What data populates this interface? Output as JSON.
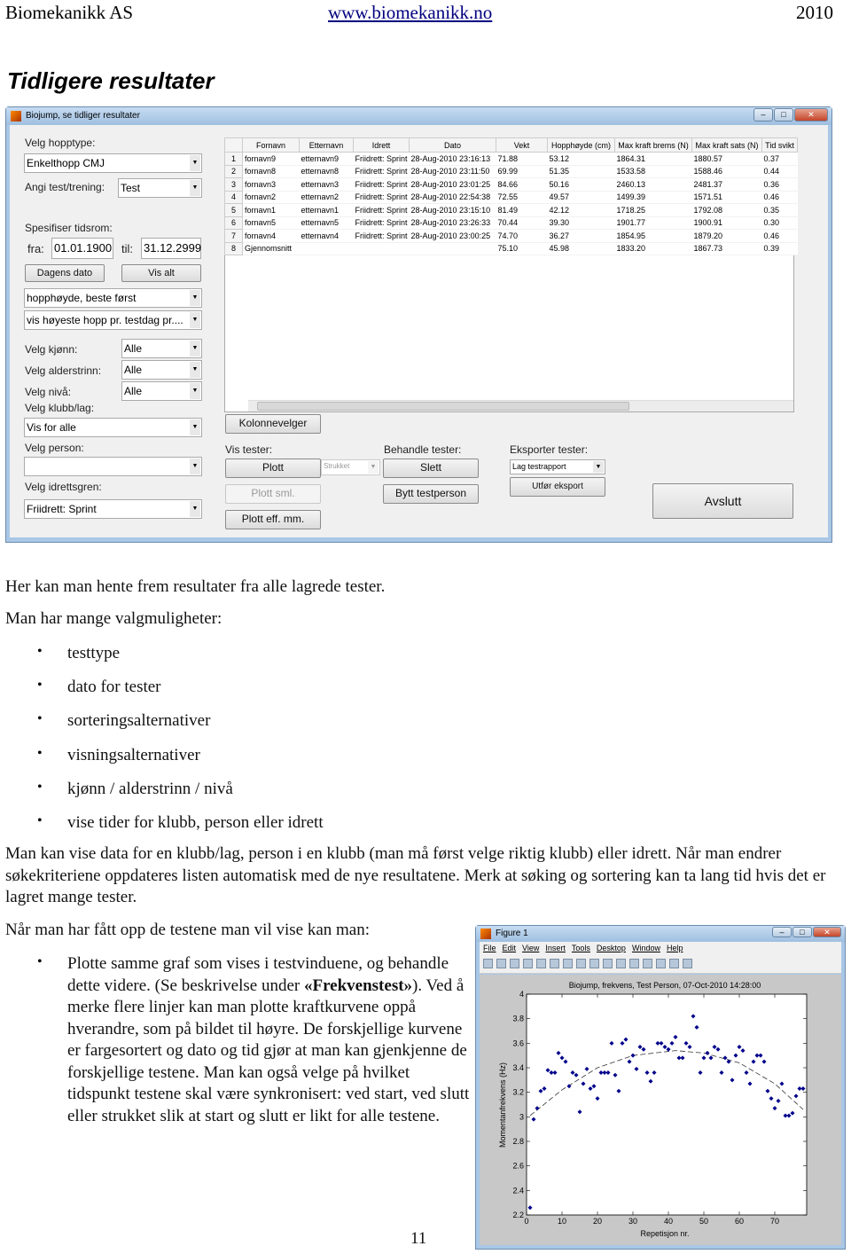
{
  "header": {
    "company": "Biomekanikk AS",
    "url": "www.biomekanikk.no",
    "year": "2010"
  },
  "title": "Tidligere resultater",
  "app": {
    "window_title": "Biojump, se tidliger resultater",
    "labels": {
      "hopptype": "Velg hopptype:",
      "test_trening": "Angi test/trening:",
      "tidsrom": "Spesifiser tidsrom:",
      "fra": "fra:",
      "til": "til:",
      "kjonn": "Velg kjønn:",
      "alderstrinn": "Velg alderstrinn:",
      "niva": "Velg nivå:",
      "klubb": "Velg klubb/lag:",
      "person": "Velg person:",
      "idrettsgren": "Velg idrettsgren:",
      "vis_tester": "Vis tester:",
      "behandle_tester": "Behandle tester:",
      "eksporter_tester": "Eksporter tester:"
    },
    "values": {
      "hopptype": "Enkelthopp CMJ",
      "test_trening": "Test",
      "fra": "01.01.1900",
      "til": "31.12.2999",
      "sortering": "hopphøyde, beste først",
      "visning": "vis høyeste hopp pr. testdag pr....",
      "kjonn": "Alle",
      "alderstrinn": "Alle",
      "niva": "Alle",
      "klubb": "Vis for alle",
      "person": "",
      "idrettsgren": "Friidrett: Sprint",
      "strukket": "Strukket",
      "eksport": "Lag testrapport"
    },
    "buttons": {
      "dagens_dato": "Dagens dato",
      "vis_alt": "Vis alt",
      "kolonnevelger": "Kolonnevelger",
      "plott": "Plott",
      "plott_sml": "Plott sml.",
      "plott_eff": "Plott eff. mm.",
      "slett": "Slett",
      "bytt": "Bytt testperson",
      "utfor": "Utfør eksport",
      "avslutt": "Avslutt"
    },
    "table": {
      "columns": [
        "Fornavn",
        "Etternavn",
        "Idrett",
        "Dato",
        "Vekt",
        "Hopphøyde (cm)",
        "Max kraft brems (N)",
        "Max kraft sats (N)",
        "Tid svikt"
      ],
      "rows": [
        [
          "1",
          "fornavn9",
          "etternavn9",
          "Friidrett: Sprint",
          "28-Aug-2010 23:16:13",
          "71.88",
          "53.12",
          "1864.31",
          "1880.57",
          "0.37"
        ],
        [
          "2",
          "fornavn8",
          "etternavn8",
          "Friidrett: Sprint",
          "28-Aug-2010 23:11:50",
          "69.99",
          "51.35",
          "1533.58",
          "1588.46",
          "0.44"
        ],
        [
          "3",
          "fornavn3",
          "etternavn3",
          "Friidrett: Sprint",
          "28-Aug-2010 23:01:25",
          "84.66",
          "50.16",
          "2460.13",
          "2481.37",
          "0.36"
        ],
        [
          "4",
          "fornavn2",
          "etternavn2",
          "Friidrett: Sprint",
          "28-Aug-2010 22:54:38",
          "72.55",
          "49.57",
          "1499.39",
          "1571.51",
          "0.46"
        ],
        [
          "5",
          "fornavn1",
          "etternavn1",
          "Friidrett: Sprint",
          "28-Aug-2010 23:15:10",
          "81.49",
          "42.12",
          "1718.25",
          "1792.08",
          "0.35"
        ],
        [
          "6",
          "fornavn5",
          "etternavn5",
          "Friidrett: Sprint",
          "28-Aug-2010 23:26:33",
          "70.44",
          "39.30",
          "1901.77",
          "1900.91",
          "0.30"
        ],
        [
          "7",
          "fornavn4",
          "etternavn4",
          "Friidrett: Sprint",
          "28-Aug-2010 23:00:25",
          "74.70",
          "36.27",
          "1854.95",
          "1879.20",
          "0.46"
        ],
        [
          "8",
          "Gjennomsnitt",
          "",
          "",
          "",
          "75.10",
          "45.98",
          "1833.20",
          "1867.73",
          "0.39"
        ]
      ]
    }
  },
  "body": {
    "p1": "Her kan man hente frem resultater fra alle lagrede tester.",
    "p2": "Man har mange valgmuligheter:",
    "bullets": [
      "testtype",
      "dato for tester",
      "sorteringsalternativer",
      "visningsalternativer",
      "kjønn / alderstrinn / nivå",
      "vise tider for klubb, person eller idrett"
    ],
    "p3": "Man kan vise data for en klubb/lag, person i en klubb (man må først velge riktig klubb) eller idrett. Når man endrer søkekriteriene oppdateres listen automatisk med de nye resultatene. Merk at søking og sortering kan ta lang tid hvis det er lagret mange tester.",
    "p4": "Når man har fått opp de testene man vil vise kan man:",
    "bullet2_pre": "Plotte samme graf som vises i testvinduene, og behandle dette videre. (Se beskrivelse under ",
    "bullet2_bold": "«Frekvenstest»",
    "bullet2_post": "). Ved å merke flere linjer kan man plotte kraftkurvene oppå hverandre, som på bildet til høyre. De forskjellige kurvene er fargesortert og dato og tid gjør at man kan gjenkjenne de forskjellige testene. Man kan også velge på hvilket tidspunkt testene skal være synkronisert: ved start, ved slutt eller strukket slik at start og slutt er likt for alle testene.",
    "page_number": "11"
  },
  "figure": {
    "window_title": "Figure 1",
    "menu": [
      "File",
      "Edit",
      "View",
      "Insert",
      "Tools",
      "Desktop",
      "Window",
      "Help"
    ]
  },
  "chart_data": {
    "type": "scatter",
    "title": "Biojump, frekvens, Test Person, 07-Oct-2010 14:28:00",
    "xlabel": "Repetisjon nr.",
    "ylabel": "Momentanfrekvens (Hz)",
    "xlim": [
      0,
      79
    ],
    "ylim": [
      2.2,
      4
    ],
    "xticks": [
      0,
      10,
      20,
      30,
      40,
      50,
      60,
      70
    ],
    "yticks": [
      2.2,
      2.4,
      2.6,
      2.8,
      3,
      3.2,
      3.4,
      3.6,
      3.8,
      4
    ],
    "marker_color": "#00008b",
    "x": [
      1,
      2,
      3,
      4,
      5,
      6,
      7,
      8,
      9,
      10,
      11,
      12,
      13,
      14,
      15,
      16,
      17,
      18,
      19,
      20,
      21,
      22,
      23,
      24,
      25,
      26,
      27,
      28,
      29,
      30,
      31,
      32,
      33,
      34,
      35,
      36,
      37,
      38,
      39,
      40,
      41,
      42,
      43,
      44,
      45,
      46,
      47,
      48,
      49,
      50,
      51,
      52,
      53,
      54,
      55,
      56,
      57,
      58,
      59,
      60,
      61,
      62,
      63,
      64,
      65,
      66,
      67,
      68,
      69,
      70,
      71,
      72,
      73,
      74,
      75,
      76,
      77,
      78
    ],
    "y": [
      2.26,
      2.98,
      3.07,
      3.21,
      3.23,
      3.38,
      3.36,
      3.36,
      3.52,
      3.48,
      3.45,
      3.25,
      3.36,
      3.34,
      3.04,
      3.27,
      3.39,
      3.23,
      3.25,
      3.15,
      3.36,
      3.36,
      3.36,
      3.6,
      3.34,
      3.21,
      3.6,
      3.63,
      3.45,
      3.5,
      3.39,
      3.57,
      3.55,
      3.36,
      3.29,
      3.36,
      3.6,
      3.6,
      3.57,
      3.55,
      3.6,
      3.65,
      3.48,
      3.48,
      3.6,
      3.57,
      3.82,
      3.73,
      3.36,
      3.48,
      3.52,
      3.48,
      3.57,
      3.55,
      3.36,
      3.48,
      3.45,
      3.3,
      3.5,
      3.57,
      3.54,
      3.36,
      3.27,
      3.45,
      3.5,
      3.5,
      3.45,
      3.21,
      3.15,
      3.07,
      3.13,
      3.27,
      3.01,
      3.01,
      3.03,
      3.17,
      3.23,
      3.23
    ],
    "trend": {
      "x": [
        1,
        10,
        20,
        30,
        42,
        50,
        60,
        70,
        78
      ],
      "y": [
        3.01,
        3.22,
        3.4,
        3.5,
        3.54,
        3.52,
        3.44,
        3.27,
        3.06
      ]
    }
  }
}
